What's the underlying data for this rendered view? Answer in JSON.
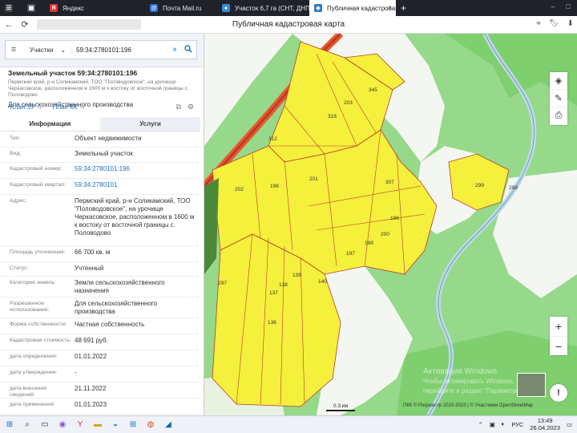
{
  "browser": {
    "tabs": [
      {
        "label": "",
        "icon": "yandex-icon",
        "active": false
      },
      {
        "label": "Яндекс",
        "icon": "yandex-icon",
        "active": false
      },
      {
        "label": "Почта Mail.ru",
        "icon": "mail-icon",
        "active": false
      },
      {
        "label": "Участок 6,7 га (СНТ, ДНП)",
        "icon": "avito-icon",
        "active": false
      },
      {
        "label": "Публичная кадастровая",
        "icon": "pkk-icon",
        "active": true
      }
    ],
    "page_title": "Публичная кадастровая карта"
  },
  "search": {
    "type": "Участки",
    "value": "59:34:2780101:196"
  },
  "object": {
    "title": "Земельный участок 59:34:2780101:196",
    "address_short": "Пермский край, р-н Соликамский, ТОО \"Половодовское\", на урочище Черкасовское, расположенном в 1600 м к востоку от восточной границы с. Половодово",
    "purpose": "Для сельскохозяйственного производства",
    "links": [
      "План ЗУ →",
      "План КК →"
    ]
  },
  "panel_tabs": [
    "Информация",
    "Услуги"
  ],
  "info_rows": [
    {
      "label": "Тип:",
      "value": "Объект недвижимости",
      "link": false
    },
    {
      "label": "Вид:",
      "value": "Земельный участок",
      "link": false
    },
    {
      "label": "Кадастровый номер:",
      "value": "59:34:2780101:196",
      "link": true
    },
    {
      "label": "Кадастровый квартал:",
      "value": "59:34:2780101",
      "link": true
    },
    {
      "label": "Адрес:",
      "value": "Пермский край, р-н Соликамский, ТОО \"Половодовское\", на урочище Черкасовское, расположенном в 1600 м к востоку от восточной границы с. Половодово",
      "link": false
    },
    {
      "label": "Площадь уточненная:",
      "value": "66 700 кв. м",
      "link": false
    },
    {
      "label": "Статус:",
      "value": "Учтенный",
      "link": false
    },
    {
      "label": "Категория земель:",
      "value": "Земли сельскохозяйственного назначения",
      "link": false
    },
    {
      "label": "Разрешенное использование:",
      "value": "Для сельскохозяйственного производства",
      "link": false
    },
    {
      "label": "Форма собственности:",
      "value": "Частная собственность",
      "link": false
    },
    {
      "label": "Кадастровая стоимость:",
      "value": "48 691 руб.",
      "link": false
    },
    {
      "label": "дата определения:",
      "value": "01.01.2022",
      "link": false
    },
    {
      "label": "дата утверждения:",
      "value": "-",
      "link": false
    },
    {
      "label": "дата внесения сведений:",
      "value": "21.11.2022",
      "link": false
    },
    {
      "label": "дата применения:",
      "value": "01.01.2023",
      "link": false
    }
  ],
  "map": {
    "parcel_labels": [
      "345",
      "203",
      "318",
      "312",
      "201",
      "307",
      "202",
      "198",
      "196",
      "200",
      "199",
      "197",
      "297",
      "138",
      "139",
      "137",
      "136",
      "140",
      "299",
      "299"
    ],
    "scale": "0.3 км",
    "attribution": "ПКК © Росреестр 2010-2023 | © Участники OpenStreetMap",
    "activation_title": "Активация Windows",
    "activation_sub": "Чтобы активировать Windows, перейдите в раздел \"Параметры\"."
  },
  "taskbar": {
    "lang": "РУС",
    "time": "13:49",
    "date": "26.04.2023"
  },
  "colors": {
    "parcel": "#f5f03c",
    "parcel_border": "#c0392b",
    "map_green": "#96d98a",
    "accent": "#1a73c9"
  }
}
